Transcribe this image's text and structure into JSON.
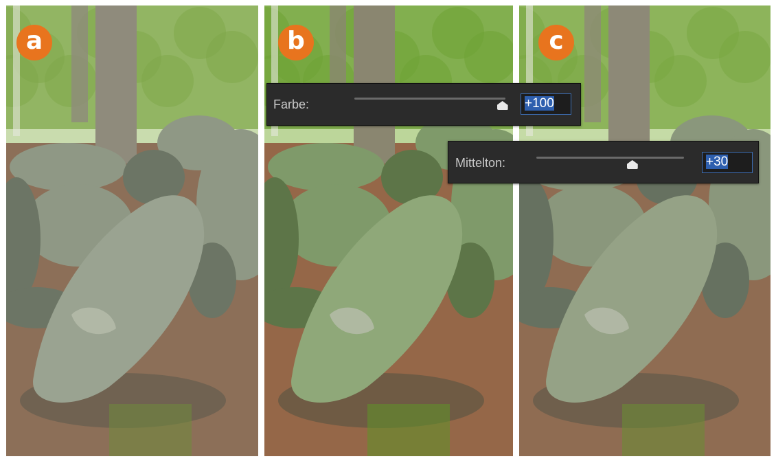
{
  "panels": [
    {
      "id": "a",
      "badge": "a",
      "variant": "original"
    },
    {
      "id": "b",
      "badge": "b",
      "variant": "farbe"
    },
    {
      "id": "c",
      "badge": "c",
      "variant": "mittelton"
    }
  ],
  "controls": {
    "farbe": {
      "label": "Farbe:",
      "value": "+100",
      "fraction": 0.98
    },
    "mittelton": {
      "label": "Mittelton:",
      "value": "+30",
      "fraction": 0.65
    }
  },
  "colors": {
    "badge": "#e8741e",
    "slider_bg": "#2b2b2b",
    "value_highlight": "#2e5fae"
  }
}
